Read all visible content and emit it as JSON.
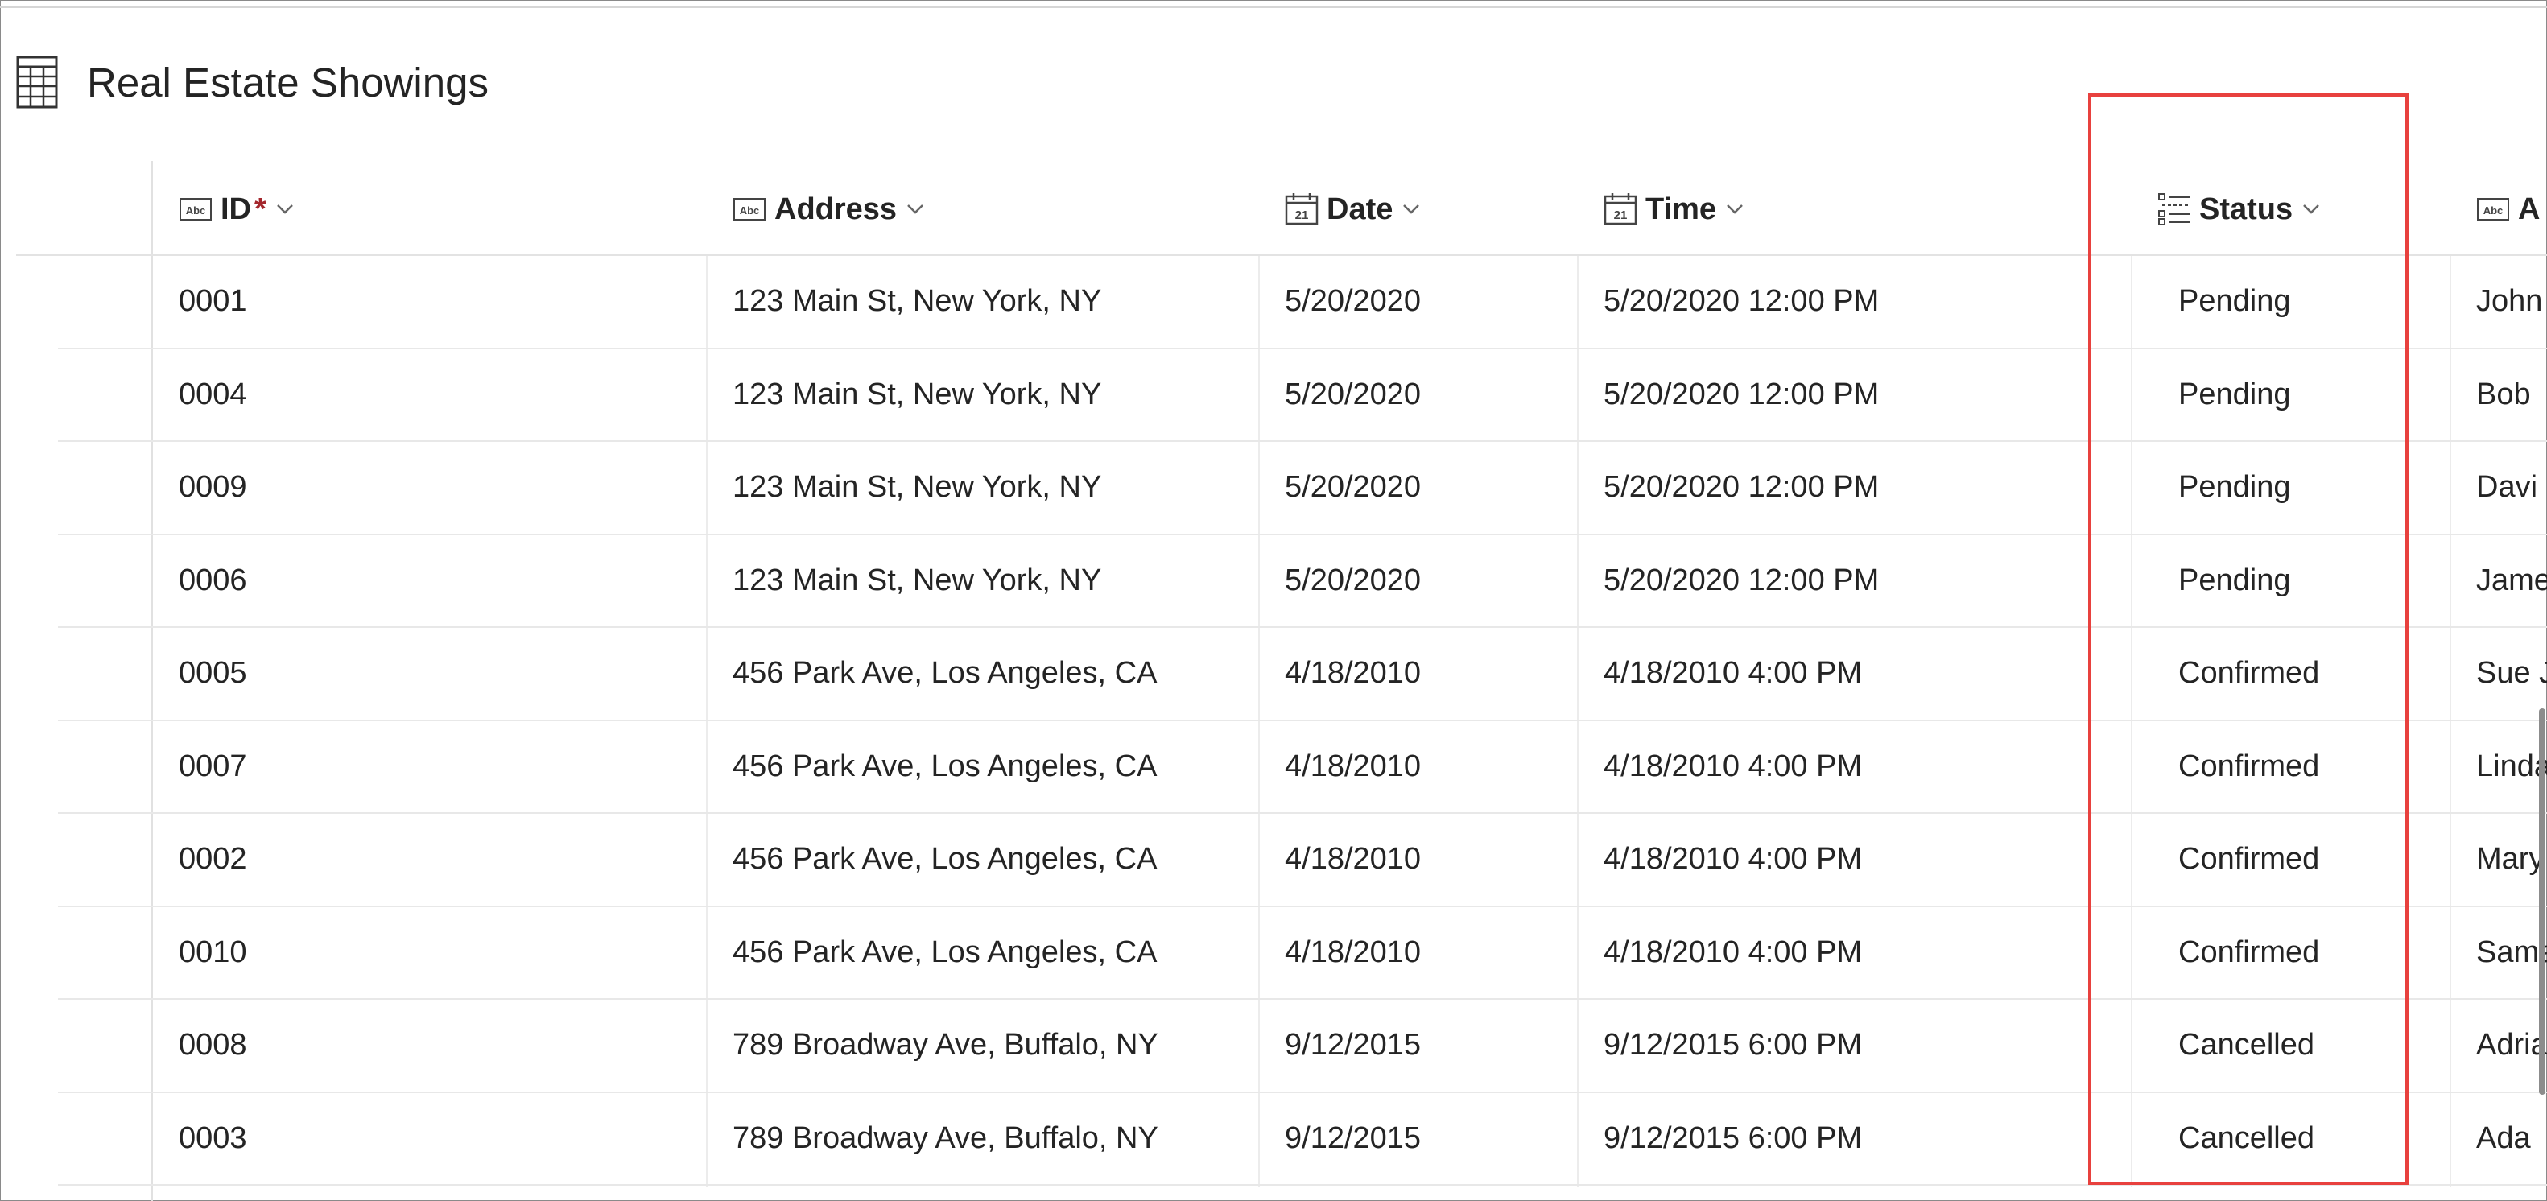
{
  "page": {
    "title": "Real Estate Showings",
    "title_icon": "table-grid-icon"
  },
  "columns": [
    {
      "key": "id",
      "label": "ID",
      "required_mark": "*",
      "icon": "text-abc-icon"
    },
    {
      "key": "address",
      "label": "Address",
      "icon": "text-abc-icon"
    },
    {
      "key": "date",
      "label": "Date",
      "icon": "calendar-icon"
    },
    {
      "key": "time",
      "label": "Time",
      "icon": "calendar-icon"
    },
    {
      "key": "status",
      "label": "Status",
      "icon": "choice-list-icon"
    },
    {
      "key": "agent",
      "label": "A",
      "icon": "text-abc-icon"
    }
  ],
  "rows": [
    {
      "id": "0001",
      "address": "123 Main St, New York, NY",
      "date": "5/20/2020",
      "time": "5/20/2020 12:00 PM",
      "status": "Pending",
      "agent": "John"
    },
    {
      "id": "0004",
      "address": "123 Main St, New York, NY",
      "date": "5/20/2020",
      "time": "5/20/2020 12:00 PM",
      "status": "Pending",
      "agent": "Bob"
    },
    {
      "id": "0009",
      "address": "123 Main St, New York, NY",
      "date": "5/20/2020",
      "time": "5/20/2020 12:00 PM",
      "status": "Pending",
      "agent": "Davi"
    },
    {
      "id": "0006",
      "address": "123 Main St, New York, NY",
      "date": "5/20/2020",
      "time": "5/20/2020 12:00 PM",
      "status": "Pending",
      "agent": "Jame"
    },
    {
      "id": "0005",
      "address": "456 Park Ave, Los Angeles, CA",
      "date": "4/18/2010",
      "time": "4/18/2010 4:00 PM",
      "status": "Confirmed",
      "agent": "Sue J"
    },
    {
      "id": "0007",
      "address": "456 Park Ave, Los Angeles, CA",
      "date": "4/18/2010",
      "time": "4/18/2010 4:00 PM",
      "status": "Confirmed",
      "agent": "Linda"
    },
    {
      "id": "0002",
      "address": "456 Park Ave, Los Angeles, CA",
      "date": "4/18/2010",
      "time": "4/18/2010 4:00 PM",
      "status": "Confirmed",
      "agent": "Mary"
    },
    {
      "id": "0010",
      "address": "456 Park Ave, Los Angeles, CA",
      "date": "4/18/2010",
      "time": "4/18/2010 4:00 PM",
      "status": "Confirmed",
      "agent": "Sama"
    },
    {
      "id": "0008",
      "address": "789 Broadway Ave, Buffalo, NY",
      "date": "9/12/2015",
      "time": "9/12/2015 6:00 PM",
      "status": "Cancelled",
      "agent": "Adria"
    },
    {
      "id": "0003",
      "address": "789 Broadway Ave, Buffalo, NY",
      "date": "9/12/2015",
      "time": "9/12/2015 6:00 PM",
      "status": "Cancelled",
      "agent": "Ada"
    }
  ],
  "colors": {
    "highlight": "#e8413e",
    "required": "#a4262c",
    "text": "#242424"
  }
}
